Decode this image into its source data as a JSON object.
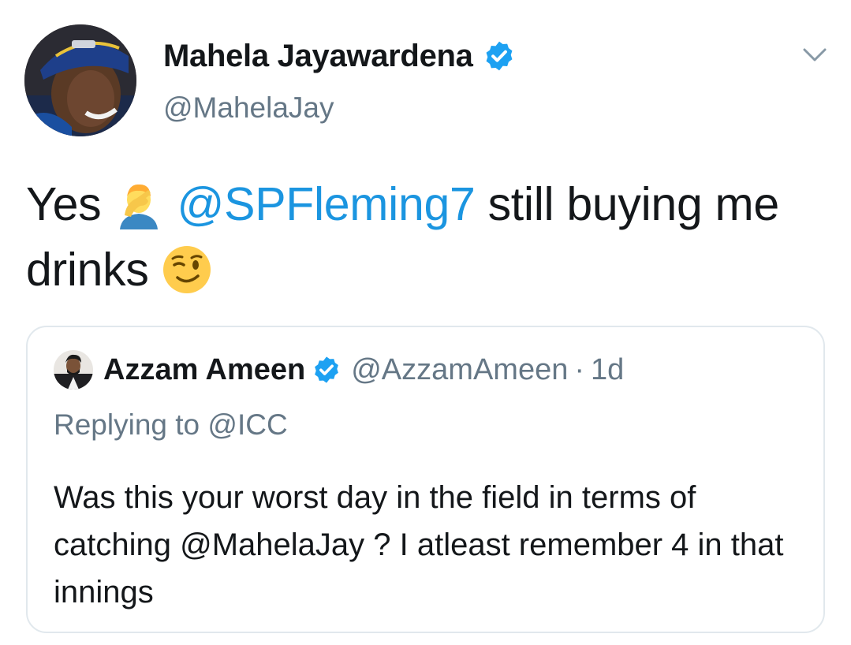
{
  "tweet": {
    "display_name": "Mahela Jayawardena",
    "handle": "@MahelaJay",
    "text_before": "Yes",
    "mention": "@SPFleming7",
    "text_after": "still buying me drinks",
    "emoji_1": "face-palm-emoji",
    "emoji_2": "winking-face-emoji",
    "menu_icon": "chevron-down-icon",
    "verified_icon": "verified-badge-icon"
  },
  "quoted": {
    "display_name": "Azzam Ameen",
    "handle": "@AzzamAmeen",
    "separator": "·",
    "time": "1d",
    "replying_to_label": "Replying to",
    "replying_to_handle": "@ICC",
    "text": "Was this your worst day in the field in terms of catching @MahelaJay ? I atleast remember 4 in that innings"
  },
  "colors": {
    "primary_text": "#14171a",
    "secondary_text": "#657786",
    "link": "#1b95e0",
    "verified": "#1da1f2",
    "border": "#e1e8ed"
  }
}
